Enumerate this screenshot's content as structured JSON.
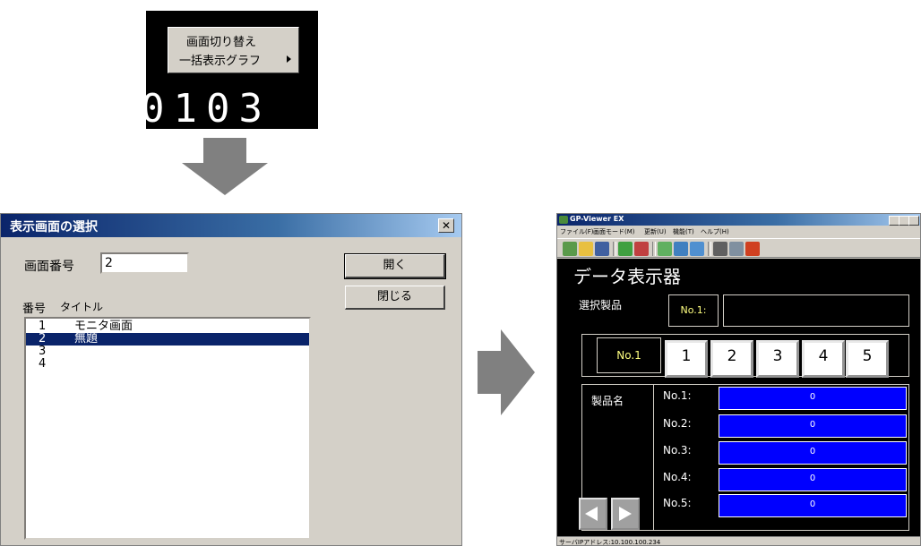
{
  "context_menu": {
    "items": [
      "画面切り替え",
      "一括表示グラフ"
    ],
    "background_digits": "0103"
  },
  "dialog": {
    "title": "表示画面の選択",
    "close_glyph": "✕",
    "screen_number_label": "画面番号",
    "screen_number_value": "2",
    "open_button": "開く",
    "close_button": "閉じる",
    "col_number": "番号",
    "col_title": "タイトル",
    "rows": [
      {
        "num": "1",
        "title": "モニタ画面"
      },
      {
        "num": "2",
        "title": "無題"
      },
      {
        "num": "3",
        "title": ""
      },
      {
        "num": "4",
        "title": ""
      }
    ],
    "selected_row": "2"
  },
  "viewer": {
    "title": "GP-Viewer EX",
    "menu": [
      "ファイル(F)",
      "画面モード(M)",
      "更新(U)",
      "機能(T)",
      "ヘルプ(H)"
    ],
    "status": "サーバIPアドレス:10.100.100.234",
    "screen": {
      "title": "データ表示器",
      "selected_label": "選択製品",
      "selected_value": "No.1:",
      "number_display": "No.1",
      "number_buttons": [
        "1",
        "2",
        "3",
        "4",
        "5"
      ],
      "product_label": "製品名",
      "products": [
        {
          "label": "No.1:",
          "value": "0"
        },
        {
          "label": "No.2:",
          "value": "0"
        },
        {
          "label": "No.3:",
          "value": "0"
        },
        {
          "label": "No.4:",
          "value": "0"
        },
        {
          "label": "No.5:",
          "value": "0"
        }
      ]
    }
  },
  "colors": {
    "title_bar": "#0a246a",
    "selection": "#0a246a",
    "value_box": "#0000ff",
    "arrow": "#808080"
  }
}
